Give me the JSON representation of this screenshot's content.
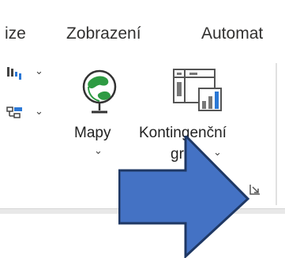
{
  "tabs": [
    {
      "label": "ize"
    },
    {
      "label": "Zobrazení"
    },
    {
      "label": "Automat"
    }
  ],
  "ribbon": {
    "maps_button": {
      "label": "Mapy",
      "icon": "globe-icon"
    },
    "pivot_chart_button": {
      "label_line1": "Kontingenční",
      "label_line2": "graf",
      "icon": "pivot-chart-icon"
    },
    "chevron": "⌄"
  },
  "colors": {
    "arrow_fill": "#4472c4",
    "arrow_stroke": "#1f3864"
  }
}
